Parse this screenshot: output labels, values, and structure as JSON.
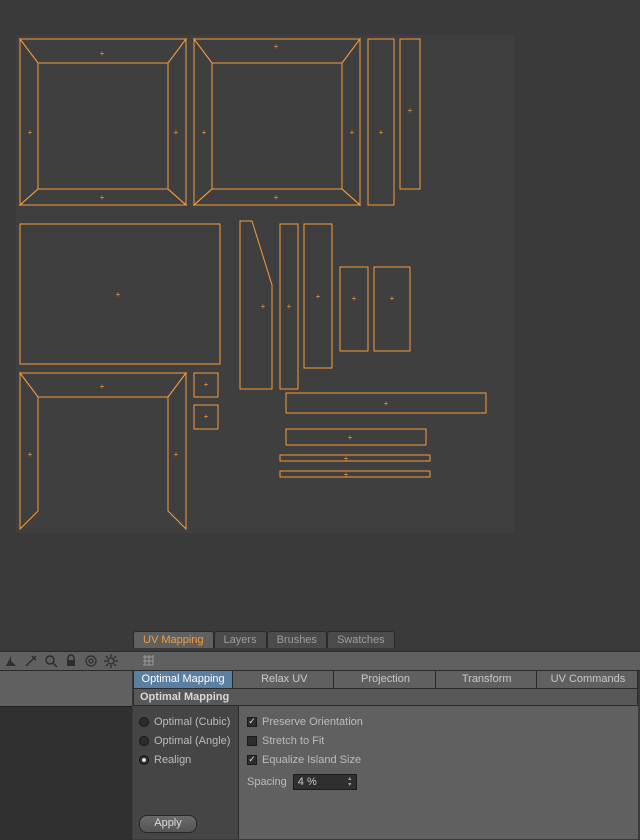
{
  "tabs": {
    "items": [
      "UV Mapping",
      "Layers",
      "Brushes",
      "Swatches"
    ],
    "active": 0
  },
  "subtabs": {
    "items": [
      "Optimal Mapping",
      "Relax UV",
      "Projection",
      "Transform",
      "UV Commands"
    ],
    "active": 0
  },
  "section": {
    "header": "Optimal Mapping"
  },
  "radios": {
    "opt_cubic": "Optimal (Cubic)",
    "opt_angle": "Optimal (Angle)",
    "realign": "Realign",
    "selected": "realign"
  },
  "checks": {
    "preserve": {
      "label": "Preserve Orientation",
      "checked": true
    },
    "stretch": {
      "label": "Stretch to Fit",
      "checked": false
    },
    "equalize": {
      "label": "Equalize Island Size",
      "checked": true
    }
  },
  "spacing": {
    "label": "Spacing",
    "value": "4 %"
  },
  "apply": {
    "label": "Apply"
  }
}
